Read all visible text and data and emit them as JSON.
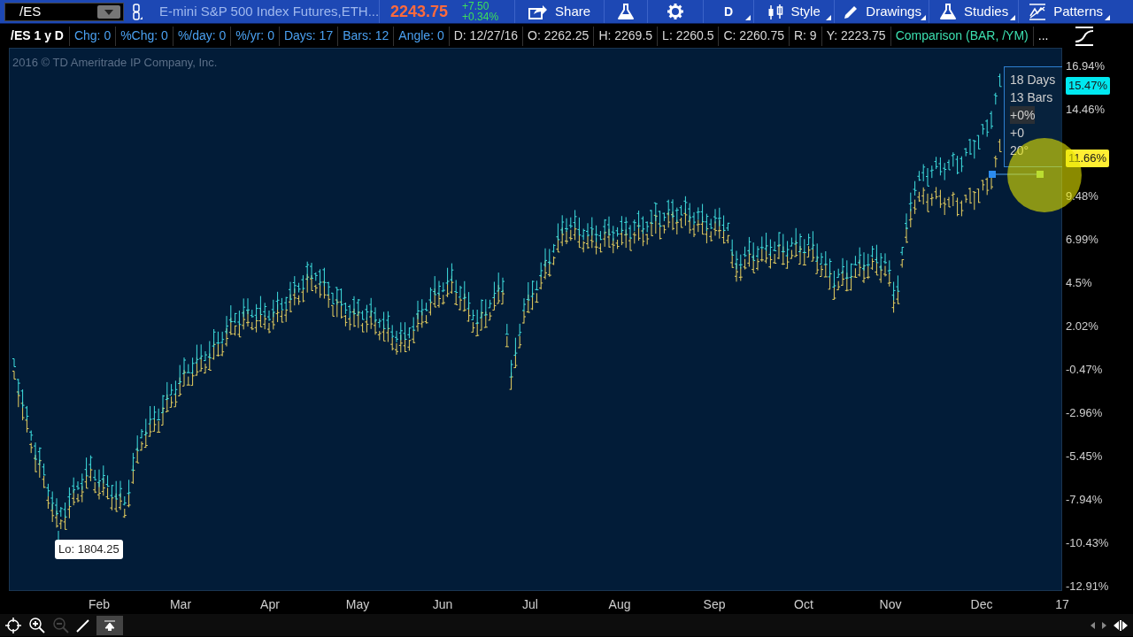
{
  "toolbar": {
    "symbol": "/ES",
    "description": "E-mini S&P 500 Index Futures,ETH...",
    "last_price": "2243.75",
    "change": "+7.50",
    "change_percent": "+0.34%",
    "buttons": [
      {
        "kind": "share",
        "label": "Share"
      },
      {
        "kind": "flask"
      },
      {
        "kind": "gear"
      },
      {
        "kind": "text",
        "label": "D"
      },
      {
        "kind": "candles",
        "label": "Style"
      },
      {
        "kind": "pencil",
        "label": "Drawings"
      },
      {
        "kind": "flask",
        "label": "Studies"
      },
      {
        "kind": "patterns",
        "label": "Patterns"
      }
    ]
  },
  "info_bar": {
    "title": "/ES 1 y D",
    "items": [
      {
        "kind": "study",
        "text": "Chg: 0"
      },
      {
        "kind": "study",
        "text": "%Chg: 0"
      },
      {
        "kind": "study",
        "text": "%/day: 0"
      },
      {
        "kind": "study",
        "text": "%/yr: 0"
      },
      {
        "kind": "study",
        "text": "Days: 17"
      },
      {
        "kind": "study",
        "text": "Bars: 12"
      },
      {
        "kind": "study",
        "text": "Angle: 0"
      },
      {
        "kind": "quote",
        "text": "D: 12/27/16"
      },
      {
        "kind": "quote",
        "text": "O: 2262.25"
      },
      {
        "kind": "quote",
        "text": "H: 2269.5"
      },
      {
        "kind": "quote",
        "text": "L: 2260.5"
      },
      {
        "kind": "quote",
        "text": "C: 2260.75"
      },
      {
        "kind": "quote",
        "text": "R: 9"
      },
      {
        "kind": "quote",
        "text": "Y: 2223.75"
      },
      {
        "kind": "comparison",
        "text": "Comparison (BAR, /YM)"
      }
    ],
    "more": "..."
  },
  "chart": {
    "copyright": "2016 © TD Ameritrade IP Company, Inc.",
    "y_ticks": [
      "16.94%",
      "14.46%",
      "9.48%",
      "6.99%",
      "4.5%",
      "2.02%",
      "-0.47%",
      "-2.96%",
      "-5.45%",
      "-7.94%",
      "-10.43%",
      "-12.91%"
    ],
    "x_ticks": [
      "Feb",
      "Mar",
      "Apr",
      "May",
      "Jun",
      "Jul",
      "Aug",
      "Sep",
      "Oct",
      "Nov",
      "Dec",
      "17"
    ],
    "low_label": "Lo: 1804.25",
    "series": [
      {
        "color": "#3fe0e0"
      },
      {
        "color": "#e8d060"
      }
    ],
    "price_tags": [
      {
        "text": "15.47%",
        "color": "#00e8f0"
      },
      {
        "text": "11.66%",
        "color": "#ffee33"
      }
    ],
    "measure": [
      "18 Days",
      "13 Bars",
      "+0%",
      "+0",
      "20°"
    ]
  }
}
